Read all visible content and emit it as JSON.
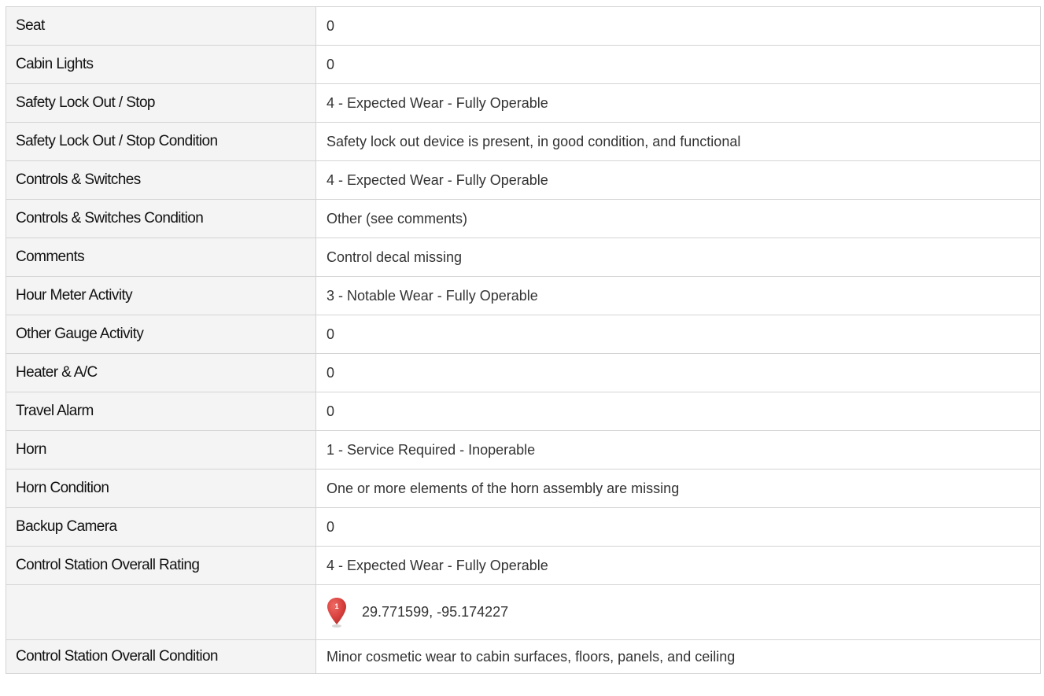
{
  "rows": [
    {
      "label": "Seat",
      "value": "0"
    },
    {
      "label": "Cabin Lights",
      "value": "0"
    },
    {
      "label": "Safety Lock Out / Stop",
      "value": "4 - Expected Wear - Fully Operable"
    },
    {
      "label": "Safety Lock Out / Stop Condition",
      "value": "Safety lock out device is present, in good condition, and functional"
    },
    {
      "label": "Controls & Switches",
      "value": "4 - Expected Wear - Fully Operable"
    },
    {
      "label": "Controls & Switches Condition",
      "value": "Other (see comments)"
    },
    {
      "label": "Comments",
      "value": "Control decal missing"
    },
    {
      "label": "Hour Meter Activity",
      "value": "3 - Notable Wear - Fully Operable"
    },
    {
      "label": "Other Gauge Activity",
      "value": "0"
    },
    {
      "label": "Heater & A/C",
      "value": "0"
    },
    {
      "label": "Travel Alarm",
      "value": "0"
    },
    {
      "label": "Horn",
      "value": "1 - Service Required - Inoperable"
    },
    {
      "label": "Horn Condition",
      "value": "One or more elements of the horn assembly are missing"
    },
    {
      "label": "Backup Camera",
      "value": "0"
    },
    {
      "label": "Control Station Overall Rating",
      "value": "4 - Expected Wear - Fully Operable"
    }
  ],
  "location": {
    "pin_number": "1",
    "pin_icon": "map-marker-icon",
    "pin_color": "#d9413e",
    "coordinates": "29.771599, -95.174227"
  },
  "final_row": {
    "label": "Control Station Overall Condition",
    "value": "Minor cosmetic wear to cabin surfaces, floors, panels, and ceiling"
  },
  "colors": {
    "label_background": "#f4f4f4",
    "border": "#d4d4d4",
    "value_text": "#333333",
    "label_text": "#111111"
  }
}
